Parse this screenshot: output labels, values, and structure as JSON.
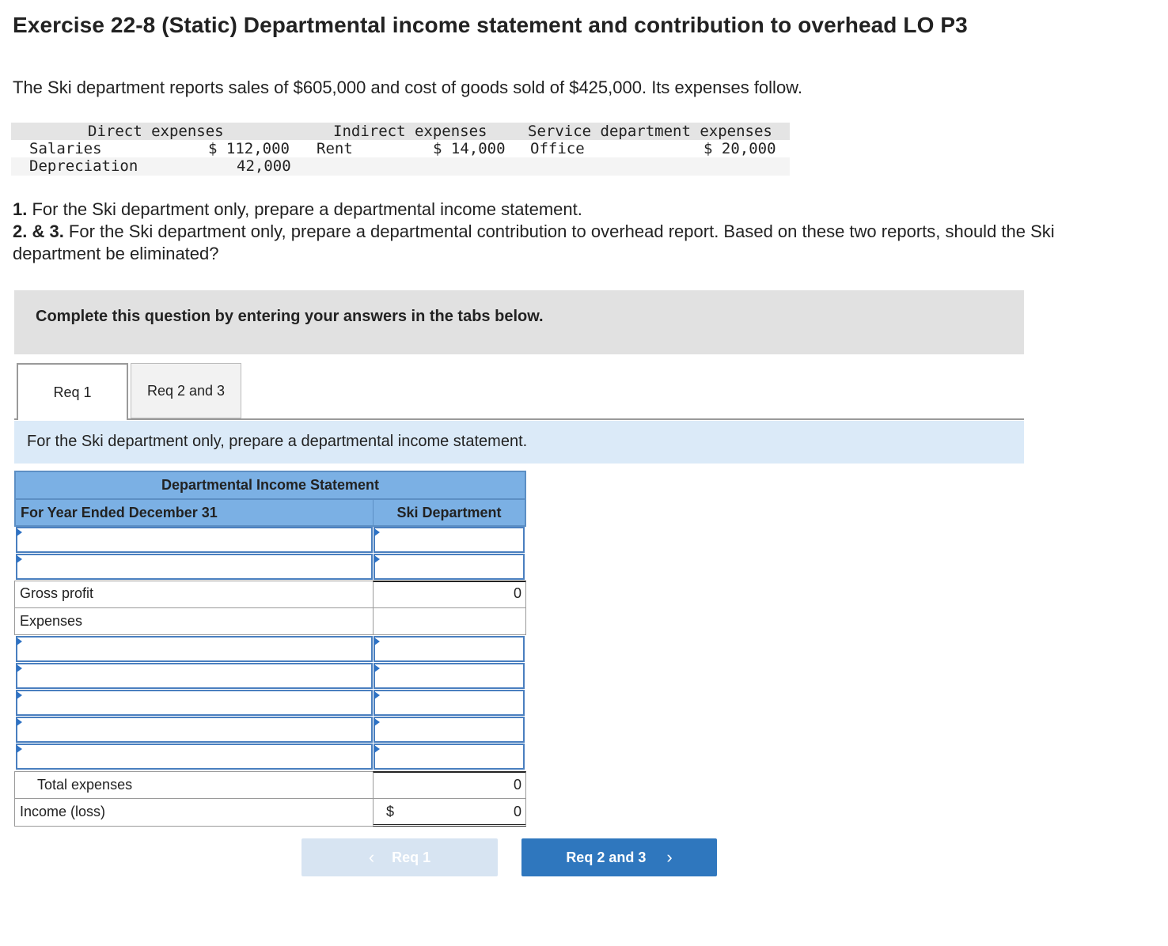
{
  "title": "Exercise 22-8 (Static) Departmental income statement and contribution to overhead LO P3",
  "intro": "The Ski department reports sales of $605,000 and cost of goods sold of $425,000. Its expenses follow.",
  "expenses_table": {
    "headers": {
      "direct": "Direct expenses",
      "indirect": "Indirect expenses",
      "service": "Service department expenses"
    },
    "salaries_label": "Salaries",
    "salaries_value": "$ 112,000",
    "depreciation_label": "Depreciation",
    "depreciation_value": "42,000",
    "rent_label": "Rent",
    "rent_value": "$ 14,000",
    "office_label": "Office",
    "office_value": "$ 20,000"
  },
  "requirements": {
    "r1_num": "1.",
    "r1_text": " For the Ski department only, prepare a departmental income statement.",
    "r23_num": "2. & 3.",
    "r23_text": " For the Ski department only, prepare a departmental contribution to overhead report. Based on these two reports, should the Ski department be eliminated?"
  },
  "instruction": "Complete this question by entering your answers in the tabs below.",
  "tabs": [
    {
      "label": "Req 1",
      "active": true
    },
    {
      "label": "Req 2 and 3",
      "active": false
    }
  ],
  "prompt": "For the Ski department only, prepare a departmental income statement.",
  "statement": {
    "title": "Departmental Income Statement",
    "period": "For Year Ended December 31",
    "column": "Ski Department",
    "gross_profit_label": "Gross profit",
    "gross_profit_value": "0",
    "expenses_label": "Expenses",
    "total_expenses_label": "Total expenses",
    "total_expenses_value": "0",
    "income_label": "Income (loss)",
    "income_currency": "$",
    "income_value": "0"
  },
  "nav": {
    "prev_label": "Req 1",
    "next_label": "Req 2 and 3",
    "prev_icon": "chevron-left-icon",
    "next_icon": "chevron-right-icon"
  },
  "colors": {
    "header_blue": "#7bb0e4",
    "prompt_bg": "#dbeaf8",
    "next_button": "#2f77be",
    "prev_button": "#d7e4f2"
  }
}
